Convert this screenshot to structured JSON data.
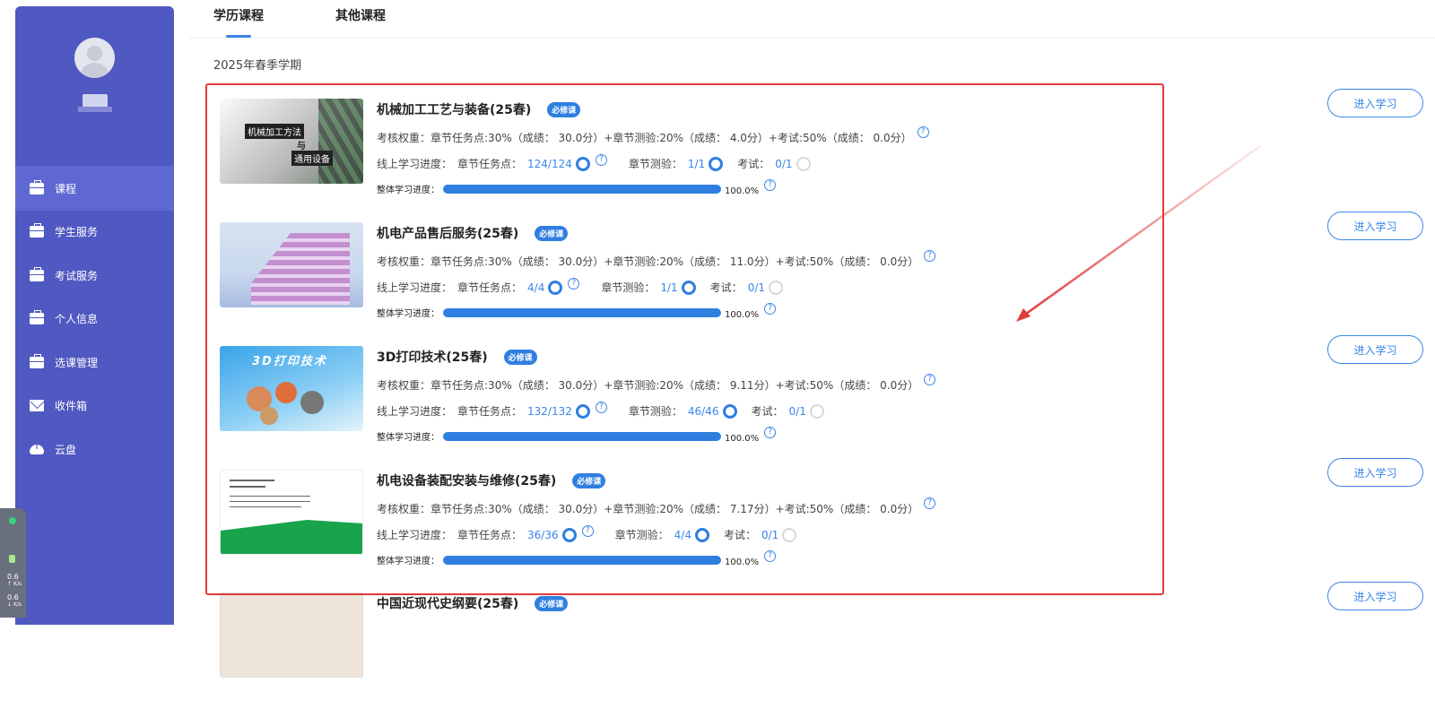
{
  "sidebar": {
    "items": [
      {
        "label": "课程",
        "icon": "briefcase-icon"
      },
      {
        "label": "学生服务",
        "icon": "briefcase-icon"
      },
      {
        "label": "考试服务",
        "icon": "briefcase-icon"
      },
      {
        "label": "个人信息",
        "icon": "briefcase-icon"
      },
      {
        "label": "选课管理",
        "icon": "briefcase-icon"
      },
      {
        "label": "收件箱",
        "icon": "mail-icon"
      },
      {
        "label": "云盘",
        "icon": "cloud-upload-icon"
      }
    ],
    "accent": "#5058c1"
  },
  "speed_widget": {
    "up": "0.6",
    "up_unit": "K/s",
    "down": "0.6",
    "down_unit": "K/s"
  },
  "tabs": [
    {
      "label": "学历课程",
      "active": true
    },
    {
      "label": "其他课程",
      "active": false
    }
  ],
  "semester": "2025年春季学期",
  "labels": {
    "required": "必修课",
    "weight_prefix": "考核权重：",
    "online_progress": "线上学习进度：",
    "chapter_task": "章节任务点：",
    "chapter_quiz": "章节测验：",
    "exam": "考试：",
    "overall": "整体学习进度：",
    "enter": "进入学习",
    "help": "?"
  },
  "courses": [
    {
      "title": "机械加工工艺与装备(25春)",
      "weights": "章节任务点:30%（成绩：  30.0分）+章节测验:20%（成绩：  4.0分）+考试:50%（成绩：  0.0分）",
      "task": "124/124",
      "quiz": "1/1",
      "exam": "0/1",
      "overall_percent": "100.0%",
      "thumb_text": [
        "机械加工方法",
        "与",
        "通用设备"
      ]
    },
    {
      "title": "机电产品售后服务(25春)",
      "weights": "章节任务点:30%（成绩：  30.0分）+章节测验:20%（成绩：  11.0分）+考试:50%（成绩：  0.0分）",
      "task": "4/4",
      "quiz": "1/1",
      "exam": "0/1",
      "overall_percent": "100.0%"
    },
    {
      "title": "3D打印技术(25春)",
      "weights": "章节任务点:30%（成绩：  30.0分）+章节测验:20%（成绩：  9.11分）+考试:50%（成绩：  0.0分）",
      "task": "132/132",
      "quiz": "46/46",
      "exam": "0/1",
      "overall_percent": "100.0%",
      "thumb_text": [
        "3D打印技术"
      ]
    },
    {
      "title": "机电设备装配安装与维修(25春)",
      "weights": "章节任务点:30%（成绩：  30.0分）+章节测验:20%（成绩：  7.17分）+考试:50%（成绩：  0.0分）",
      "task": "36/36",
      "quiz": "4/4",
      "exam": "0/1",
      "overall_percent": "100.0%"
    },
    {
      "title": "中国近现代史纲要(25春)"
    }
  ],
  "colors": {
    "highlight": "#e23b3b",
    "progress": "#2f7fe0"
  }
}
